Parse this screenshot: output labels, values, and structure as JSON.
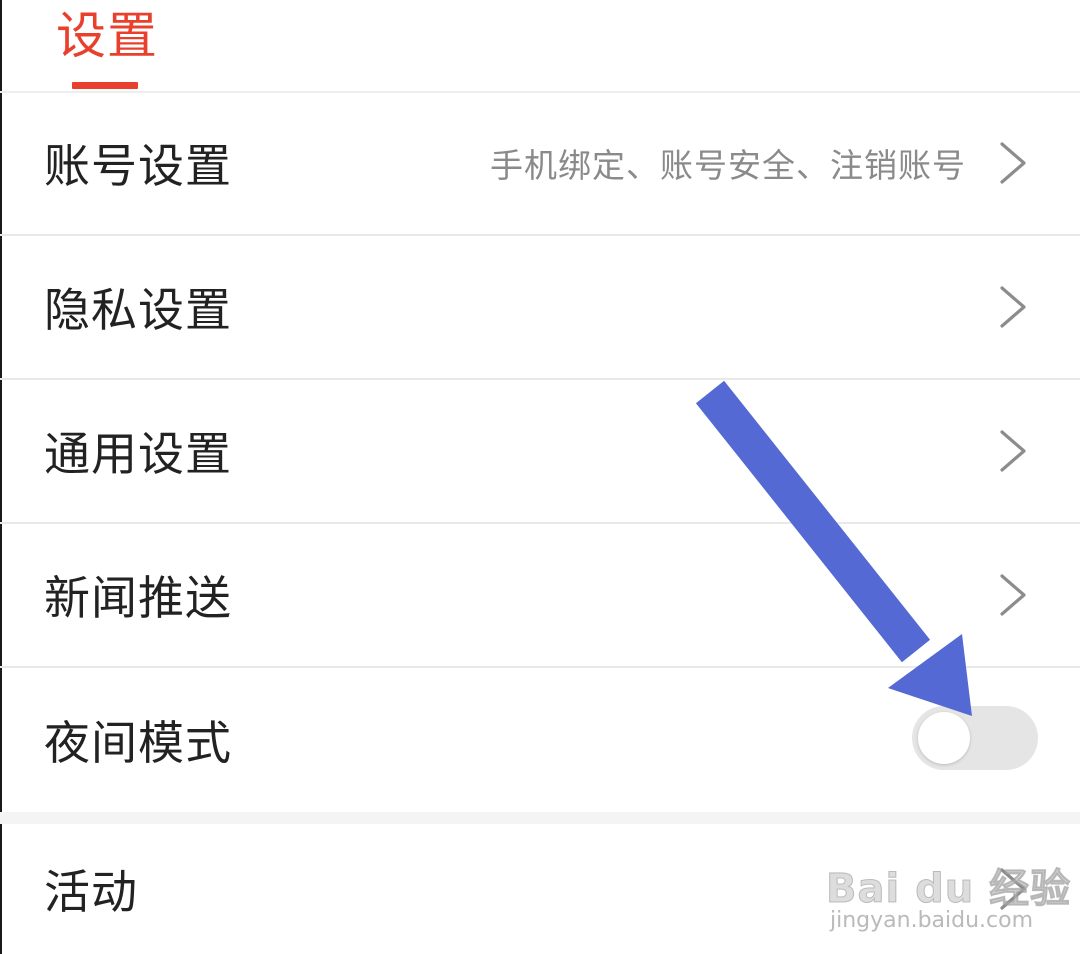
{
  "header": {
    "tab_title": "设置",
    "accent_color": "#e8402c"
  },
  "rows": [
    {
      "label": "账号设置",
      "hint": "手机绑定、账号安全、注销账号",
      "control": "chevron-right-icon"
    },
    {
      "label": "隐私设置",
      "control": "chevron-right-icon"
    },
    {
      "label": "通用设置",
      "control": "chevron-right-icon"
    },
    {
      "label": "新闻推送",
      "control": "chevron-right-icon"
    },
    {
      "label": "夜间模式",
      "control": "toggle",
      "toggle_on": false
    },
    {
      "label": "活动",
      "control": "chevron-right-icon"
    }
  ],
  "annotation": {
    "arrow_color": "#5469d4",
    "points_to": "night-mode-toggle"
  },
  "watermark": {
    "main": "Bai du 经验",
    "sub": "jingyan.baidu.com"
  }
}
